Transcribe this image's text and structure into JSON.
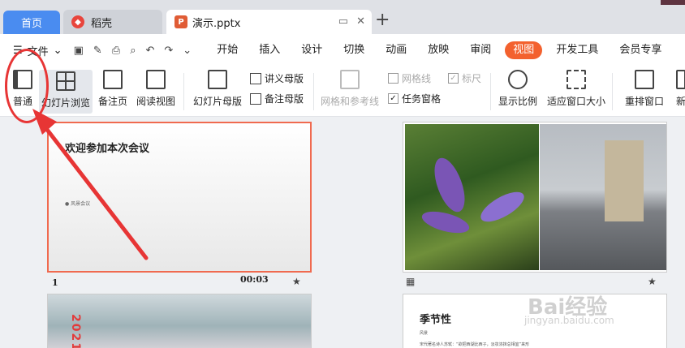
{
  "tabs": {
    "home": "首页",
    "daoke": "稻壳",
    "doc": "演示.pptx"
  },
  "menu": {
    "file": "文件",
    "items": [
      "开始",
      "插入",
      "设计",
      "切换",
      "动画",
      "放映",
      "审阅",
      "视图",
      "开发工具",
      "会员专享"
    ],
    "active_index": 7
  },
  "ribbon": {
    "normal": "普通",
    "slide_sorter": "幻灯片浏览",
    "notes_page": "备注页",
    "reading_view": "阅读视图",
    "slide_master": "幻灯片母版",
    "handout_master": "讲义母版",
    "notes_master": "备注母版",
    "grid_guides": "网格和参考线",
    "gridlines": "网格线",
    "ruler": "标尺",
    "task_pane": "任务窗格",
    "zoom": "显示比例",
    "fit_window": "适应窗口大小",
    "arrange": "重排窗口",
    "more": "新"
  },
  "slides": {
    "s1_title": "欢迎参加本次会议",
    "s1_sub": "● 风景会议",
    "s1_num": "1",
    "s1_time": "00:03",
    "s3_year": "2021",
    "s4_title": "季节性",
    "s4_line1": "风景",
    "s4_line2": "宋代著名诗人苏轼：“欲把西湖比西子，淡妆浓抹总相宜”来形"
  },
  "watermark": {
    "main": "Bai经验",
    "sub": "jingyan.baidu.com"
  },
  "colors": {
    "accent": "#f3612e",
    "home_tab": "#4a8cf0",
    "annotation": "#e73535"
  }
}
